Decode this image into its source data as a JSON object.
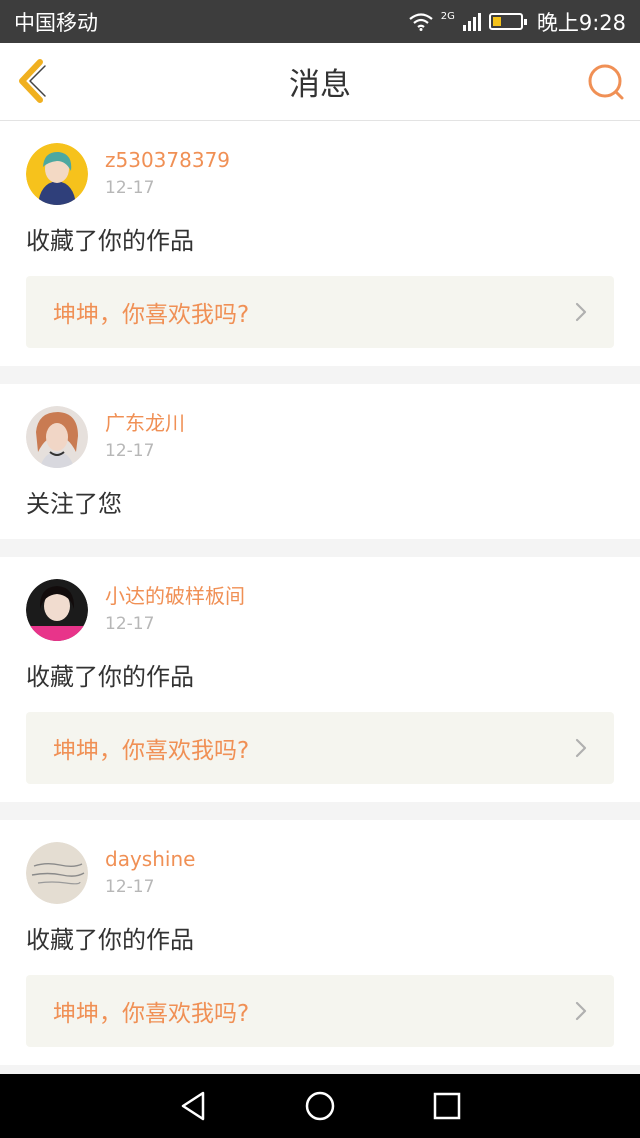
{
  "status_bar": {
    "carrier": "中国移动",
    "network": "2G",
    "time": "晚上9:28"
  },
  "header": {
    "title": "消息",
    "back_icon": "chevron-left-icon",
    "search_icon": "search-icon"
  },
  "messages": [
    {
      "username": "z530378379",
      "date": "12-17",
      "action": "收藏了你的作品",
      "work_title": "坤坤，你喜欢我吗?"
    },
    {
      "username": "广东龙川",
      "date": "12-17",
      "action": "关注了您"
    },
    {
      "username": "小达的破样板间",
      "date": "12-17",
      "action": "收藏了你的作品",
      "work_title": "坤坤，你喜欢我吗?"
    },
    {
      "username": "dayshine",
      "date": "12-17",
      "action": "收藏了你的作品",
      "work_title": "坤坤，你喜欢我吗?"
    }
  ],
  "colors": {
    "accent": "#f09055",
    "header_icon": "#f0b020",
    "work_box_bg": "#f5f5ef"
  }
}
